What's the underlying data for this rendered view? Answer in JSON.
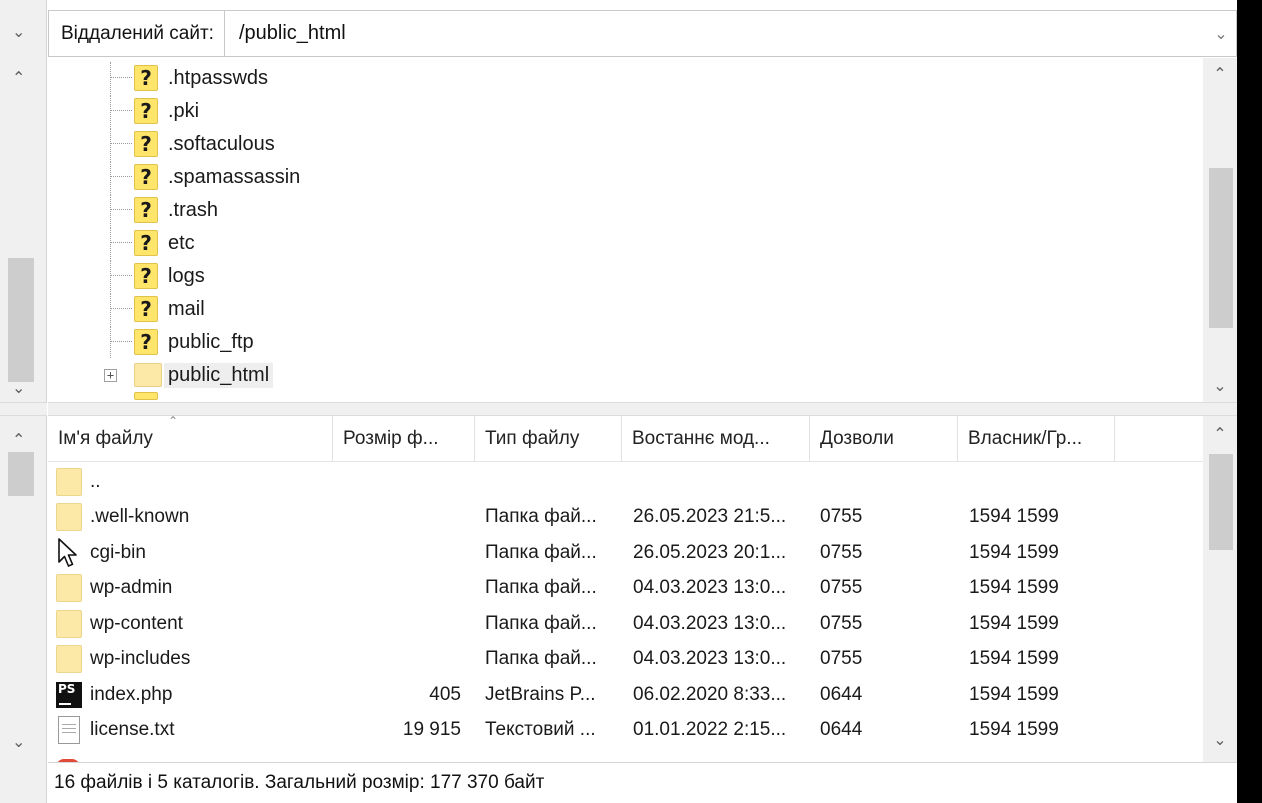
{
  "remote_site": {
    "label": "Віддалений сайт:",
    "path": "/public_html"
  },
  "tree": {
    "items": [
      {
        "name": ".htpasswds",
        "icon": "question-icon"
      },
      {
        "name": ".pki",
        "icon": "question-icon"
      },
      {
        "name": ".softaculous",
        "icon": "question-icon"
      },
      {
        "name": ".spamassassin",
        "icon": "question-icon"
      },
      {
        "name": ".trash",
        "icon": "question-icon"
      },
      {
        "name": "etc",
        "icon": "question-icon"
      },
      {
        "name": "logs",
        "icon": "question-icon"
      },
      {
        "name": "mail",
        "icon": "question-icon"
      },
      {
        "name": "public_ftp",
        "icon": "question-icon"
      },
      {
        "name": "public_html",
        "icon": "folder-icon",
        "expandable": true,
        "selected": true
      }
    ]
  },
  "file_list": {
    "columns": [
      "Ім'я файлу",
      "Розмір ф...",
      "Тип файлу",
      "Востаннє мод...",
      "Дозволи",
      "Власник/Гр..."
    ],
    "rows": [
      {
        "name": "..",
        "size": "",
        "type": "",
        "modified": "",
        "permissions": "",
        "owner": "",
        "icon": "folder-icon"
      },
      {
        "name": ".well-known",
        "size": "",
        "type": "Папка фай...",
        "modified": "26.05.2023 21:5...",
        "permissions": "0755",
        "owner": "1594 1599",
        "icon": "folder-icon"
      },
      {
        "name": "cgi-bin",
        "size": "",
        "type": "Папка фай...",
        "modified": "26.05.2023 20:1...",
        "permissions": "0755",
        "owner": "1594 1599",
        "icon": "mouse-cursor-icon"
      },
      {
        "name": "wp-admin",
        "size": "",
        "type": "Папка фай...",
        "modified": "04.03.2023 13:0...",
        "permissions": "0755",
        "owner": "1594 1599",
        "icon": "folder-icon"
      },
      {
        "name": "wp-content",
        "size": "",
        "type": "Папка фай...",
        "modified": "04.03.2023 13:0...",
        "permissions": "0755",
        "owner": "1594 1599",
        "icon": "folder-icon"
      },
      {
        "name": "wp-includes",
        "size": "",
        "type": "Папка фай...",
        "modified": "04.03.2023 13:0...",
        "permissions": "0755",
        "owner": "1594 1599",
        "icon": "folder-icon"
      },
      {
        "name": "index.php",
        "size": "405",
        "type": "JetBrains P...",
        "modified": "06.02.2020 8:33...",
        "permissions": "0644",
        "owner": "1594 1599",
        "icon": "phpstorm-icon",
        "icon_text": "PS"
      },
      {
        "name": "license.txt",
        "size": "19 915",
        "type": "Текстовий ...",
        "modified": "01.01.2022 2:15...",
        "permissions": "0644",
        "owner": "1594 1599",
        "icon": "text-file-icon"
      }
    ]
  },
  "status": {
    "text": "16 файлів і 5 каталогів. Загальний розмір: 177 370 байт"
  },
  "colors": {
    "folder": "#fce9a8",
    "unknown_icon": "#ffe66a",
    "scroll_thumb": "#cdcdcd",
    "scroll_track": "#f0f0f0"
  }
}
